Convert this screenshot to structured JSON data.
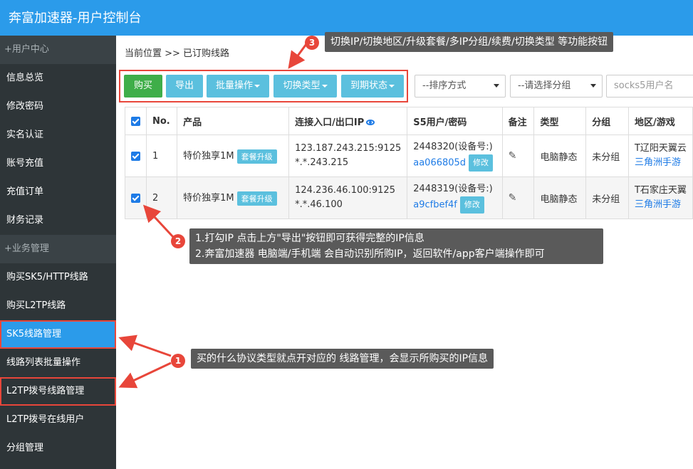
{
  "header": {
    "title": "奔富加速器-用户控制台"
  },
  "sidebar": {
    "sections": [
      {
        "label": "+用户中心",
        "items": [
          "信息总览",
          "修改密码",
          "实名认证",
          "账号充值",
          "充值订单",
          "财务记录"
        ]
      },
      {
        "label": "+业务管理",
        "items": [
          "购买SK5/HTTP线路",
          "购买L2TP线路",
          "SK5线路管理",
          "线路列表批量操作",
          "L2TP拨号线路管理",
          "L2TP拨号在线用户",
          "分组管理"
        ]
      }
    ]
  },
  "breadcrumb": "当前位置 >> 已订购线路",
  "toolbar": {
    "buy": "购买",
    "export": "导出",
    "batch": "批量操作",
    "switch_type": "切换类型",
    "expire_status": "到期状态"
  },
  "filters": {
    "sort": "--排序方式",
    "group": "--请选择分组",
    "search_placeholder": "socks5用户名"
  },
  "table": {
    "headers": [
      "No.",
      "产品",
      "连接入口/出口IP",
      "S5用户/密码",
      "备注",
      "类型",
      "分组",
      "地区/游戏"
    ],
    "rows": [
      {
        "no": "1",
        "product": "特价独享1M",
        "upgrade": "套餐升级",
        "ip_in": "123.187.243.215:9125",
        "ip_out": "*.*.243.215",
        "user": "2448320(设备号:)",
        "password": "aa066805d",
        "modify": "修改",
        "type": "电脑静态",
        "group": "未分组",
        "region": "T辽阳天翼云",
        "game": "三角洲手游"
      },
      {
        "no": "2",
        "product": "特价独享1M",
        "upgrade": "套餐升级",
        "ip_in": "124.236.46.100:9125",
        "ip_out": "*.*.46.100",
        "user": "2448319(设备号:)",
        "password": "a9cfbef4f",
        "modify": "修改",
        "type": "电脑静态",
        "group": "未分组",
        "region": "T石家庄天翼",
        "game": "三角洲手游"
      }
    ]
  },
  "annotations": {
    "badge1": "1",
    "badge2": "2",
    "badge3": "3",
    "tip1": "买的什么协议类型就点开对应的 线路管理，会显示所购买的IP信息",
    "tip2_line1": "1.打勾IP 点击上方\"导出\"按钮即可获得完整的IP信息",
    "tip2_line2": "2.奔富加速器 电脑端/手机端 会自动识别所购IP，返回软件/app客户端操作即可",
    "tip3": "切换IP/切换地区/升级套餐/多IP分组/续费/切换类型 等功能按钮"
  },
  "colors": {
    "primary": "#2b9bea",
    "green": "#3fae49",
    "cyan": "#5bc0de",
    "annotation_red": "#e8463a",
    "sidebar_bg": "#2e3538"
  }
}
